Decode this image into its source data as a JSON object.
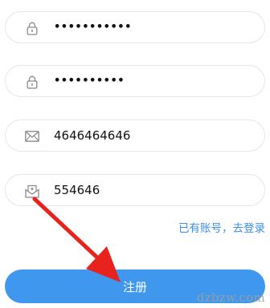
{
  "fields": [
    {
      "icon": "lock-icon",
      "value": "•••••••••••"
    },
    {
      "icon": "lock-icon",
      "value": "••••••••••"
    },
    {
      "icon": "mail-icon",
      "value": "4646464646"
    },
    {
      "icon": "verification-code-icon",
      "value": "554646"
    }
  ],
  "login_link": "已有账号，去登录",
  "register_button": "注册",
  "watermark": "dzbzw.com",
  "colors": {
    "accent": "#3f98ee",
    "link": "#3b8fe3",
    "annotation_arrow": "#e8231d"
  }
}
